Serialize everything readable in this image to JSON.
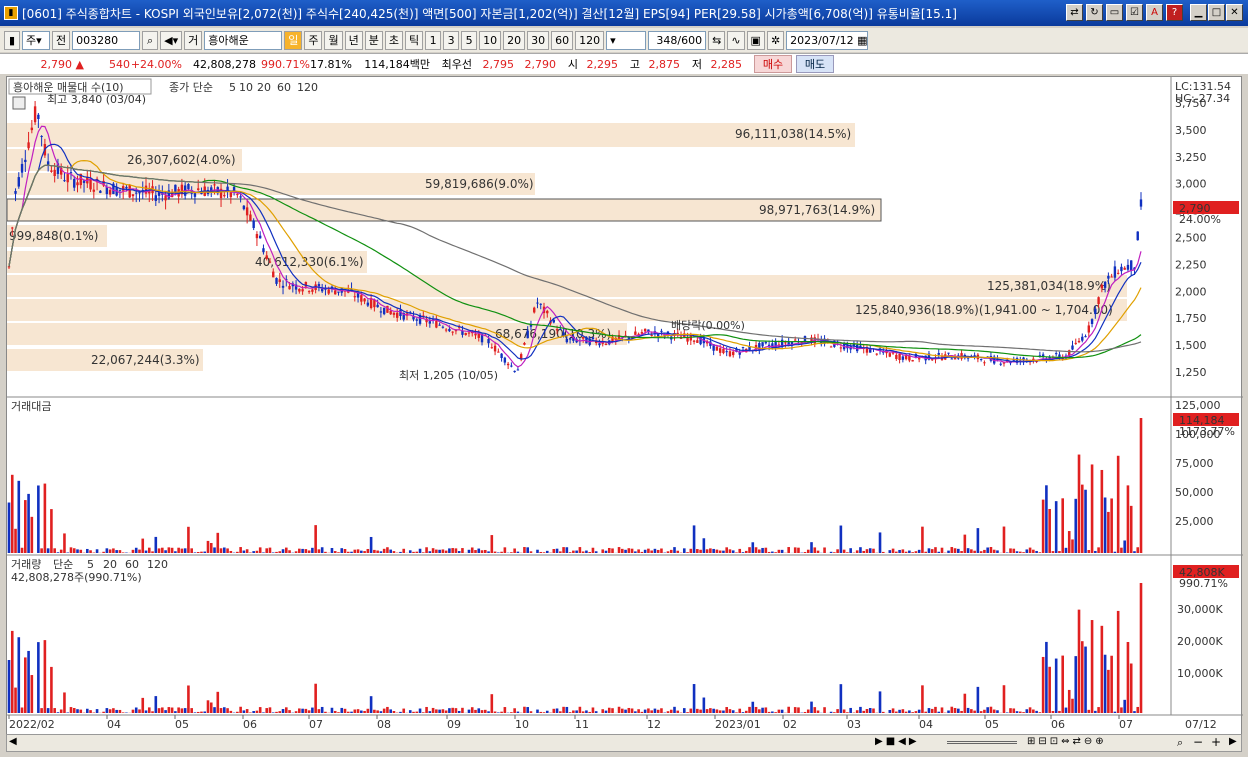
{
  "window": {
    "title": "[0601] 주식종합차트 - KOSPI 외국인보유[2,072(천)] 주식수[240,425(천)] 액면[500] 자본금[1,202(억)] 결산[12월] EPS[94] PER[29.58] 시가총액[6,708(억)] 유통비율[15.1]",
    "icon": "app-icon"
  },
  "toolbar": {
    "stock_type": "주",
    "prev_label": "전",
    "code": "003280",
    "order_button": "거",
    "stock_name": "흥아해운",
    "periods": [
      "일",
      "주",
      "월",
      "년",
      "분",
      "초",
      "틱"
    ],
    "active_period": "일",
    "intervals": [
      "1",
      "3",
      "5",
      "10",
      "20",
      "30",
      "60",
      "120"
    ],
    "count": "348",
    "count_total": "/600",
    "date": "2023/07/12"
  },
  "quote": {
    "price": "2,790",
    "arrow": "▲",
    "change": "540",
    "change_pct": "+24.00%",
    "volume": "42,808,278",
    "volume_ratio": "990.71%",
    "turnover": "17.81%",
    "amount": "114,184백만",
    "best_label": "최우선",
    "ask": "2,795",
    "bid": "2,790",
    "open_label": "시",
    "open": "2,295",
    "high_label": "고",
    "high": "2,875",
    "low_label": "저",
    "low": "2,285",
    "buy_label": "매수",
    "sell_label": "매도"
  },
  "price_panel": {
    "legend_title": "흥아해운 매물대 수(10)",
    "ma_legend": {
      "label": "종가 단순",
      "periods": [
        "5",
        "10",
        "20",
        "60",
        "120"
      ],
      "colors": [
        "#c020c0",
        "#1030c0",
        "#e0a000",
        "#109010",
        "#707070"
      ]
    },
    "lc": "LC:131.54",
    "hc": "HC:-27.34",
    "high_marker": "최고 3,840 (03/04)",
    "low_marker": "최저 1,205 (10/05)",
    "dividend": "배당락(0.00%)",
    "last_price": "2,790",
    "last_pct": "24.00%",
    "band_labels": [
      "96,111,038(14.5%)",
      "26,307,602(4.0%)",
      "59,819,686(9.0%)",
      "98,971,763(14.9%)",
      "999,848(0.1%)",
      "40,612,330(6.1%)",
      "125,381,034(18.9%)",
      "125,840,936(18.9%)(1,941.00 ~ 1,704.00)",
      "68,676,190(10.3%)",
      "22,067,244(3.3%)"
    ],
    "y_ticks": [
      "3,750",
      "3,500",
      "3,250",
      "3,000",
      "2,750",
      "2,500",
      "2,250",
      "2,000",
      "1,750",
      "1,500",
      "1,250"
    ]
  },
  "amount_panel": {
    "title": "거래대금",
    "y_ticks": [
      "125,000",
      "100,000",
      "75,000",
      "50,000",
      "25,000"
    ],
    "last_value": "114,184",
    "last_pct": "1173.77%"
  },
  "volume_panel": {
    "title": "거래량",
    "ma_label": "단순",
    "periods": [
      "5",
      "20",
      "60",
      "120"
    ],
    "info": "42,808,278주(990.71%)",
    "y_ticks": [
      "30,000K",
      "20,000K",
      "10,000K"
    ],
    "last_value": "42,808K",
    "last_pct": "990.71%"
  },
  "x_axis": [
    "2022/02",
    "04",
    "05",
    "06",
    "07",
    "08",
    "09",
    "10",
    "11",
    "12",
    "2023/01",
    "02",
    "03",
    "04",
    "05",
    "06",
    "07"
  ],
  "x_axis_right": "07/12",
  "colors": {
    "up": "#e02020",
    "down": "#1030c0",
    "band": "#f7e6d2",
    "accent": "#0a3a9c"
  }
}
